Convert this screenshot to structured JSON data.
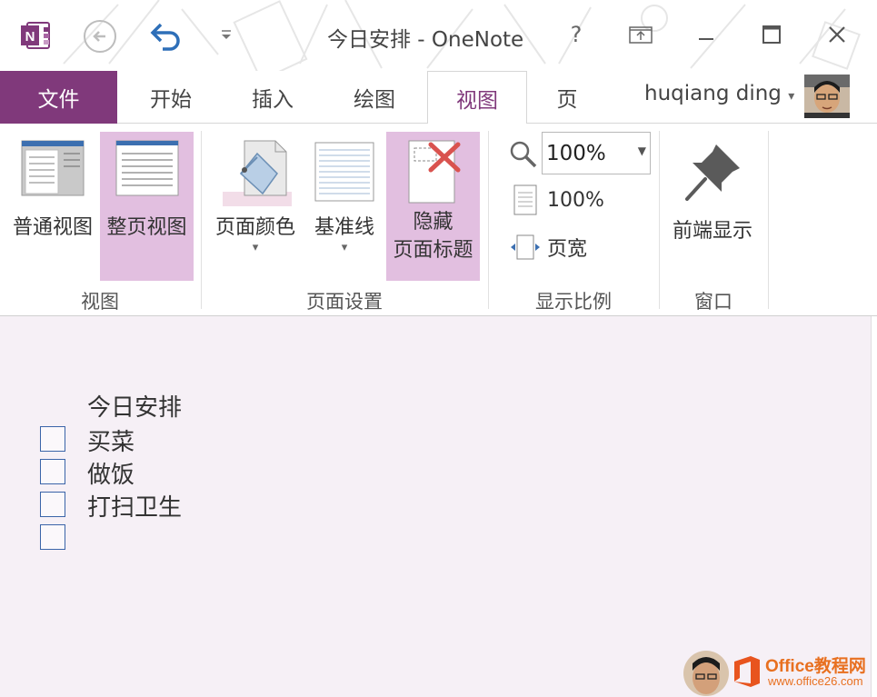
{
  "window": {
    "title": "今日安排 - OneNote",
    "help": "?"
  },
  "ribbon_tabs": {
    "file": "文件",
    "home": "开始",
    "insert": "插入",
    "draw": "绘图",
    "view": "视图",
    "page": "页",
    "active": "视图"
  },
  "account": {
    "name": "huqiang ding",
    "dropdown": "▾"
  },
  "groups": {
    "views": {
      "label": "视图",
      "normal_view": "普通视图",
      "full_page_view": "整页视图",
      "selected": "整页视图"
    },
    "page_setup": {
      "label": "页面设置",
      "page_color": "页面颜色",
      "rule_lines": "基准线",
      "hide_title_line1": "隐藏",
      "hide_title_line2": "页面标题",
      "dropdown": "▾"
    },
    "zoom": {
      "label": "显示比例",
      "zoom_value": "100%",
      "hundred_percent": "100%",
      "page_width": "页宽"
    },
    "window": {
      "label": "窗口",
      "always_on_top": "前端显示"
    }
  },
  "note": {
    "title": "今日安排",
    "todos": [
      {
        "text": "买菜",
        "checked": false
      },
      {
        "text": "做饭",
        "checked": false
      },
      {
        "text": "打扫卫生",
        "checked": false
      },
      {
        "text": "",
        "checked": false
      }
    ]
  },
  "watermark": {
    "brand": "Office教程网",
    "url": "www.office26.com"
  },
  "colors": {
    "accent": "#80397b",
    "selected_bg": "#e2bfe0",
    "page_bg": "#f6f0f6",
    "checkbox_border": "#3a64a8"
  }
}
